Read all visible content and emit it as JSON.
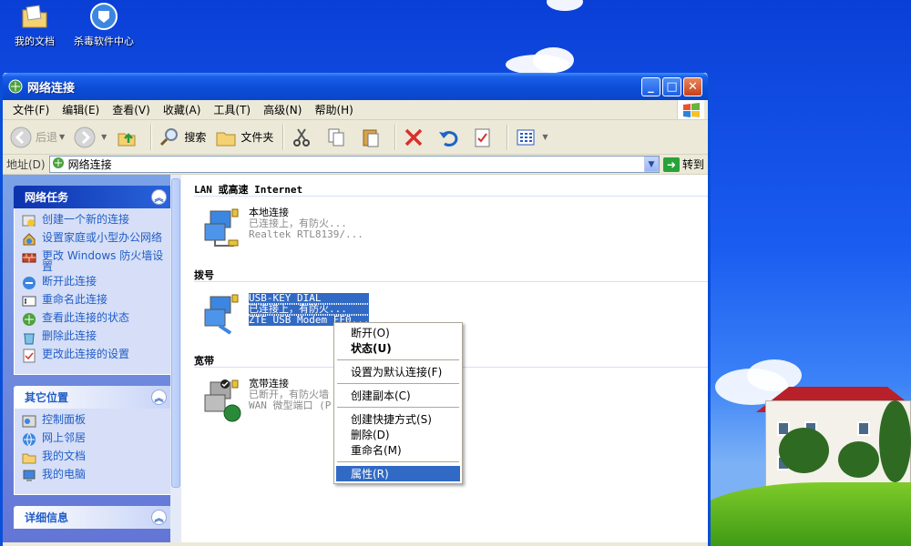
{
  "desktop": {
    "icons": [
      {
        "label": "我的文档"
      },
      {
        "label": "杀毒软件中心"
      }
    ]
  },
  "window": {
    "title": "网络连接",
    "controls": {
      "minimize": "_",
      "maximize": "□",
      "close": "✕"
    }
  },
  "menubar": {
    "items": [
      "文件(F)",
      "编辑(E)",
      "查看(V)",
      "收藏(A)",
      "工具(T)",
      "高级(N)",
      "帮助(H)"
    ]
  },
  "toolbar": {
    "back": "后退",
    "search": "搜索",
    "folders": "文件夹"
  },
  "addressbar": {
    "label": "地址(D)",
    "value": "网络连接",
    "go": "转到"
  },
  "tasks": {
    "network": {
      "title": "网络任务",
      "items": [
        "创建一个新的连接",
        "设置家庭或小型办公网络",
        "更改 Windows 防火墙设置",
        "断开此连接",
        "重命名此连接",
        "查看此连接的状态",
        "删除此连接",
        "更改此连接的设置"
      ]
    },
    "other": {
      "title": "其它位置",
      "items": [
        "控制面板",
        "网上邻居",
        "我的文档",
        "我的电脑"
      ]
    },
    "details": {
      "title": "详细信息"
    }
  },
  "content": {
    "groups": [
      {
        "title": "LAN 或高速 Internet",
        "connections": [
          {
            "name": "本地连接",
            "status": "已连接上，有防火...",
            "device": "Realtek RTL8139/..."
          }
        ]
      },
      {
        "title": "拨号",
        "connections": [
          {
            "name": "USB-KEY DIAL",
            "status": "已连接上，有防火...",
            "device": "ZTE USB Modem FF0..."
          }
        ]
      },
      {
        "title": "宽带",
        "connections": [
          {
            "name": "宽带连接",
            "status": "已断开，有防火墙",
            "device": "WAN 微型端口 (P"
          }
        ]
      }
    ]
  },
  "context_menu": {
    "items": [
      "断开(O)",
      "状态(U)",
      "设置为默认连接(F)",
      "创建副本(C)",
      "创建快捷方式(S)",
      "删除(D)",
      "重命名(M)",
      "属性(R)"
    ]
  },
  "colors": {
    "title_bar": "#0b4bd6",
    "task_pane": "#7ba2e7",
    "selection": "#316ac5"
  }
}
